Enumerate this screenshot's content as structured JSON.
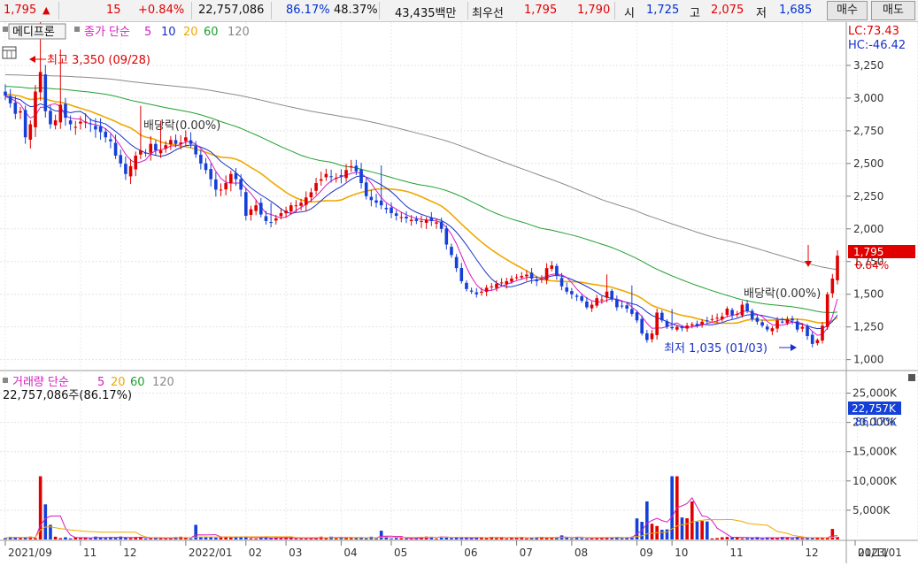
{
  "quote": {
    "price": "1,795",
    "up_arrow": "▲",
    "change": "15",
    "change_pct": "+0.84%",
    "volume": "22,757,086",
    "vol_ratio": "86.17%",
    "rate2": "48.37%",
    "amount": "43,435백만",
    "best_label": "최우선",
    "ask": "1,795",
    "bid": "1,790",
    "open_label": "시",
    "open": "1,725",
    "high_label": "고",
    "high": "2,075",
    "low_label": "저",
    "low": "1,685",
    "buy_label": "매수",
    "sell_label": "매도"
  },
  "panel": {
    "stock_name": "메디프론",
    "legend_title": "종가 단순",
    "ma": [
      "5",
      "10",
      "20",
      "60",
      "120"
    ],
    "lc_label": "LC:73.43",
    "hc_label": "HC:-46.42",
    "high_note": "최고 3,350 (09/28)",
    "low_note": "최저 1,035 (01/03)",
    "div_note1": "배당락(0.00%)",
    "div_note2": "배당락(0.00%)",
    "price_tag": "1,795",
    "price_tag_pct": "0.84%",
    "vol_title": "거래량 단순",
    "vol_value": "22,757,086주(86.17%)",
    "vol_tag": "22,757K",
    "vol_tag_pct": "86.17%"
  },
  "colors": {
    "up": "#e00000",
    "down": "#1440d8",
    "ma5": "#d81bc4",
    "ma10": "#1830c8",
    "ma20": "#f0a800",
    "ma60": "#20a030",
    "ma120": "#8a8a8a"
  },
  "chart_data": {
    "type": "candlestick",
    "price_axis": {
      "ticks": [
        "3,250",
        "3,000",
        "2,750",
        "2,500",
        "2,250",
        "2,000",
        "1,750",
        "1,500",
        "1,250",
        "1,000"
      ],
      "values": [
        3250,
        3000,
        2750,
        2500,
        2250,
        2000,
        1750,
        1500,
        1250,
        1000
      ],
      "range": [
        930,
        3500
      ]
    },
    "volume_axis": {
      "ticks": [
        "25,000K",
        "20,000K",
        "15,000K",
        "10,000K",
        "5,000K"
      ],
      "values": [
        25000,
        20000,
        15000,
        10000,
        5000
      ],
      "range": [
        0,
        27500
      ]
    },
    "x_labels": [
      "2021/09",
      "11",
      "12",
      "2022/01",
      "02",
      "03",
      "04",
      "05",
      "06",
      "07",
      "08",
      "09",
      "10",
      "11",
      "12",
      "2023/01",
      "01/11"
    ],
    "x_label_slots": [
      0,
      15,
      23,
      36,
      48,
      56,
      67,
      77,
      91,
      102,
      113,
      126,
      133,
      144,
      159,
      170,
      182
    ],
    "close": [
      3020,
      2960,
      2880,
      2900,
      2700,
      2800,
      3050,
      3200,
      2900,
      2800,
      2830,
      2950,
      2850,
      2800,
      2780,
      2820,
      2820,
      2800,
      2760,
      2740,
      2700,
      2670,
      2560,
      2500,
      2420,
      2480,
      2560,
      2600,
      2580,
      2650,
      2600,
      2600,
      2640,
      2680,
      2650,
      2660,
      2700,
      2650,
      2570,
      2500,
      2450,
      2380,
      2300,
      2300,
      2350,
      2420,
      2380,
      2300,
      2100,
      2150,
      2180,
      2110,
      2060,
      2050,
      2080,
      2120,
      2140,
      2180,
      2180,
      2200,
      2240,
      2280,
      2350,
      2380,
      2420,
      2400,
      2390,
      2400,
      2450,
      2480,
      2440,
      2350,
      2250,
      2220,
      2200,
      2180,
      2150,
      2120,
      2100,
      2090,
      2080,
      2070,
      2060,
      2060,
      2070,
      2060,
      2050,
      2000,
      1880,
      1800,
      1700,
      1600,
      1540,
      1520,
      1500,
      1520,
      1550,
      1560,
      1580,
      1590,
      1600,
      1620,
      1630,
      1640,
      1650,
      1620,
      1600,
      1620,
      1700,
      1720,
      1640,
      1560,
      1520,
      1500,
      1480,
      1450,
      1400,
      1420,
      1470,
      1460,
      1520,
      1460,
      1400,
      1410,
      1390,
      1350,
      1300,
      1200,
      1150,
      1200,
      1360,
      1300,
      1250,
      1240,
      1250,
      1240,
      1260,
      1270,
      1260,
      1290,
      1300,
      1310,
      1320,
      1330,
      1390,
      1340,
      1350,
      1420,
      1370,
      1310,
      1290,
      1260,
      1230,
      1240,
      1300,
      1290,
      1310,
      1300,
      1230,
      1250,
      1180,
      1120,
      1150,
      1260,
      1500,
      1620,
      1795
    ]
  }
}
